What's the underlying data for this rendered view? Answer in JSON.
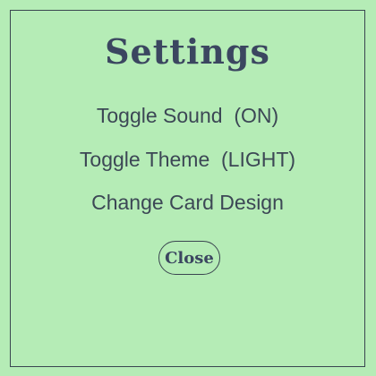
{
  "settings": {
    "title": "Settings",
    "sound_label": "Toggle Sound  (ON)",
    "theme_label": "Toggle Theme  (LIGHT)",
    "card_label": "Change Card Design",
    "close_label": "Close"
  },
  "colors": {
    "background": "#b5ecb6",
    "text": "#3c4755",
    "border": "#3a4550"
  }
}
